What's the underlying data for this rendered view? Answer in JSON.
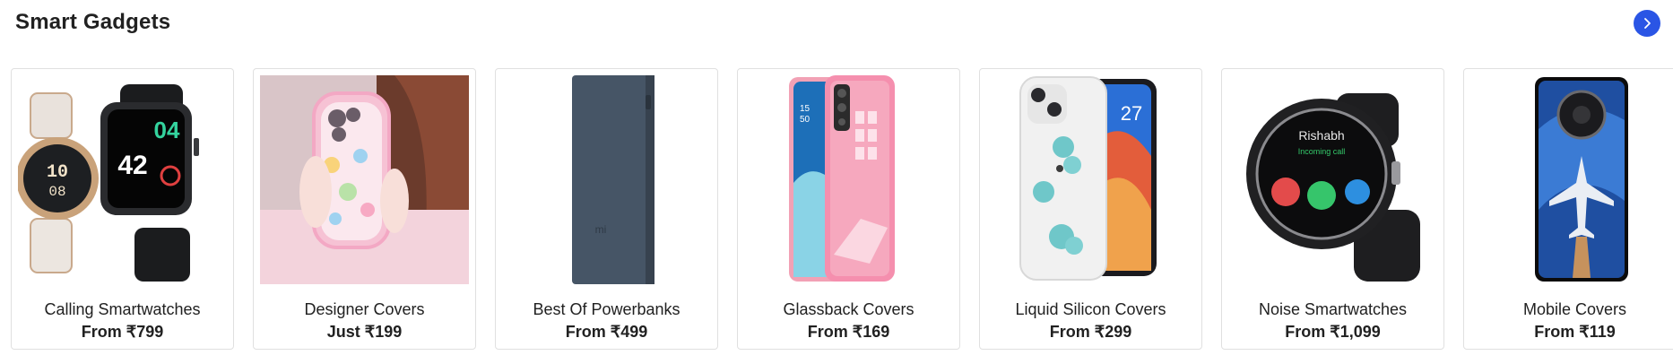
{
  "section": {
    "title": "Smart Gadgets",
    "next_icon": "chevron-right-icon",
    "accent": "#2a55e5"
  },
  "cards": [
    {
      "name": "Calling Smartwatches",
      "price": "From ₹799"
    },
    {
      "name": "Designer Covers",
      "price": "Just ₹199"
    },
    {
      "name": "Best Of Powerbanks",
      "price": "From ₹499"
    },
    {
      "name": "Glassback Covers",
      "price": "From ₹169"
    },
    {
      "name": "Liquid Silicon Covers",
      "price": "From ₹299"
    },
    {
      "name": "Noise Smartwatches",
      "price": "From ₹1,099"
    },
    {
      "name": "Mobile Covers",
      "price": "From ₹119"
    }
  ],
  "images": {
    "watch_face_time": "10",
    "watch_face_minutes": "08",
    "watch_square_hour": "04",
    "watch_square_big": "42",
    "phone_time_hours": "15",
    "phone_time_minutes": "50",
    "phone_date": "27",
    "powerbank_logo": "mi",
    "noise_caller": "Rishabh",
    "noise_status": "Incoming call"
  }
}
